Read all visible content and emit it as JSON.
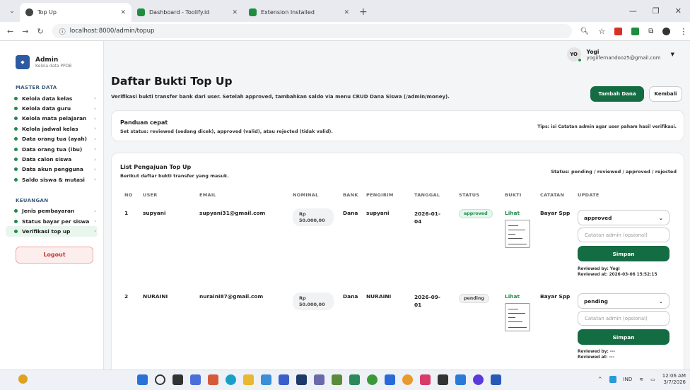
{
  "browser": {
    "tabs": [
      {
        "title": "Top Up",
        "active": true,
        "icon_color": "#444444"
      },
      {
        "title": "Dashboard - Toolify.id",
        "active": false,
        "icon_color": "#1e8e3e"
      },
      {
        "title": "Extension Installed",
        "active": false,
        "icon_color": "#1e8e3e"
      }
    ],
    "url": "localhost:8000/admin/topup"
  },
  "sidebar": {
    "brand_title": "Admin",
    "brand_subtitle": "Kelola data PPDB",
    "section_master": "MASTER DATA",
    "master_items": [
      "Kelola data kelas",
      "Kelola data guru",
      "Kelola mata pelajaran",
      "Kelola jadwal kelas",
      "Data orang tua (ayah)",
      "Data orang tua (ibu)",
      "Data calon siswa",
      "Data akun pengguna",
      "Saldo siswa & mutasi"
    ],
    "section_keuangan": "KEUANGAN",
    "keuangan_items": [
      "Jenis pembayaran",
      "Status bayar per siswa",
      "Verifikasi top up"
    ],
    "logout": "Logout"
  },
  "user": {
    "initials": "YO",
    "name": "Yogi",
    "email": "yogiifernandoo25@gmail.com"
  },
  "page": {
    "title": "Daftar Bukti Top Up",
    "subtitle": "Verifikasi bukti transfer bank dari user. Setelah approved, tambahkan saldo via menu CRUD Dana Siswa (/admin/money).",
    "add_button": "Tambah Dana",
    "back_button": "Kembali"
  },
  "guide": {
    "title": "Panduan cepat",
    "text": "Set status: reviewed (sedang dicek), approved (valid), atau rejected (tidak valid).",
    "tip": "Tips: isi Catatan admin agar user paham hasil verifikasi."
  },
  "list": {
    "title": "List Pengajuan Top Up",
    "subtitle": "Berikut daftar bukti transfer yang masuk.",
    "status_legend": "Status: pending / reviewed / approved / rejected",
    "headers": {
      "no": "NO",
      "user": "USER",
      "email": "EMAIL",
      "nominal": "NOMINAL",
      "bank": "BANK",
      "pengirim": "PENGIRIM",
      "tanggal": "TANGGAL",
      "status": "STATUS",
      "bukti": "BUKTI",
      "catatan": "CATATAN",
      "update": "UPDATE"
    },
    "rows": [
      {
        "no": "1",
        "user": "supyani",
        "email": "supyani31@gmail.com",
        "nominal_a": "Rp",
        "nominal_b": "50.000,00",
        "bank": "Dana",
        "pengirim": "supyani",
        "tanggal_a": "2026-01-",
        "tanggal_b": "04",
        "status": "approved",
        "bukti": "Lihat",
        "catatan": "Bayar Spp",
        "select": "approved",
        "note_placeholder": "Catatan admin (opsional)",
        "save": "Simpan",
        "reviewed_by": "Reviewed by: Yogi",
        "reviewed_at": "Reviewed at: 2026-03-06 15:52:15"
      },
      {
        "no": "2",
        "user": "NURAINI",
        "email": "nuraini87@gmail.com",
        "nominal_a": "Rp",
        "nominal_b": "50.000,00",
        "bank": "Dana",
        "pengirim": "NURAINI",
        "tanggal_a": "2026-09-",
        "tanggal_b": "01",
        "status": "pending",
        "bukti": "Lihat",
        "catatan": "Bayar Spp",
        "select": "pending",
        "note_placeholder": "Catatan admin (opsional)",
        "save": "Simpan",
        "reviewed_by": "Reviewed by: ---",
        "reviewed_at": "Reviewed at: ---"
      }
    ]
  },
  "taskbar": {
    "lang": "IND",
    "time": "12:06 AM",
    "date": "3/7/2026"
  },
  "colors": {
    "accent": "#146c43",
    "dot": "#1f8a4c",
    "logout": "#c0392b"
  }
}
